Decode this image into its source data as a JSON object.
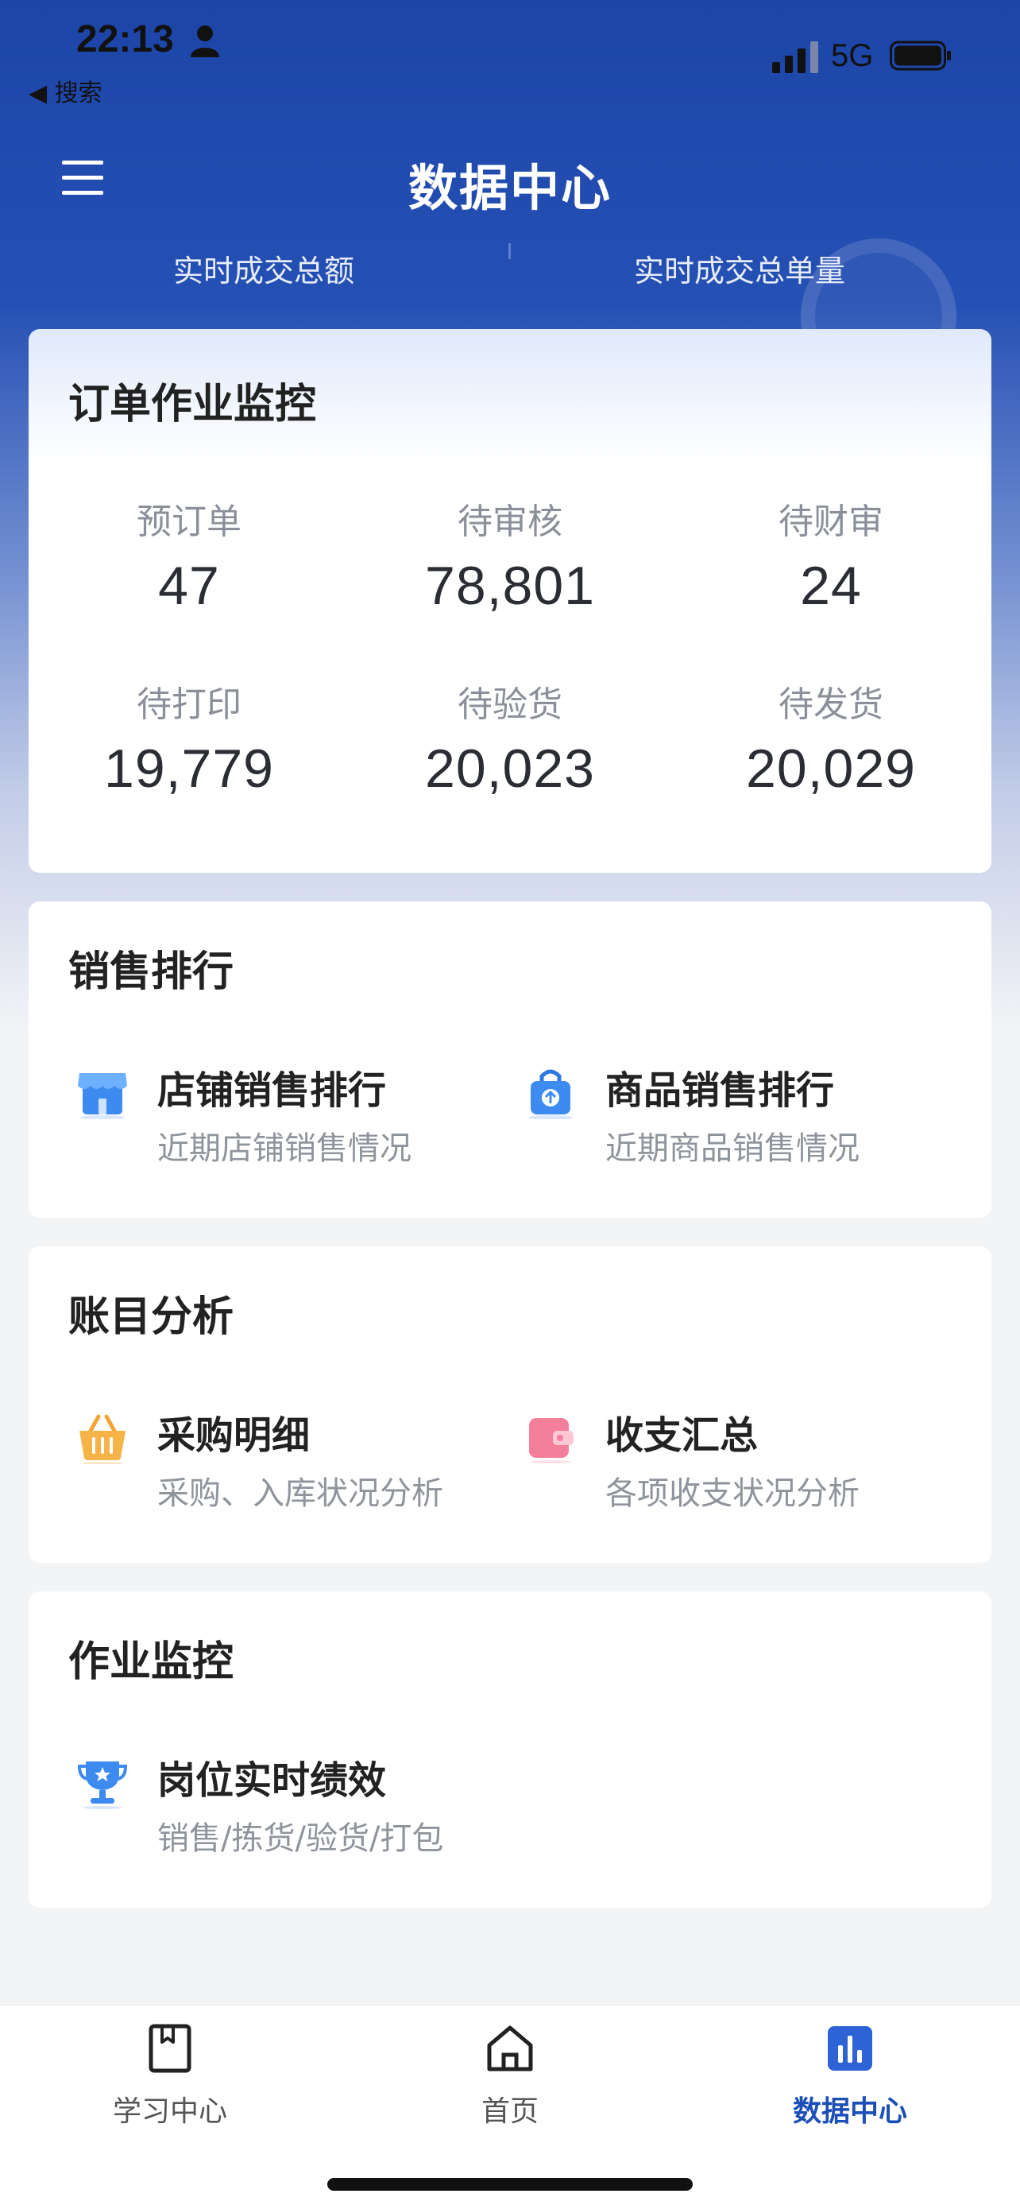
{
  "status_bar": {
    "time": "22:13",
    "back_app": "◀ 搜索",
    "network": "5G"
  },
  "header": {
    "title": "数据中心",
    "tabs": [
      "实时成交总额",
      "实时成交总单量"
    ]
  },
  "order_monitor": {
    "title": "订单作业监控",
    "metrics": [
      {
        "label": "预订单",
        "value": "47"
      },
      {
        "label": "待审核",
        "value": "78,801"
      },
      {
        "label": "待财审",
        "value": "24"
      },
      {
        "label": "待打印",
        "value": "19,779"
      },
      {
        "label": "待验货",
        "value": "20,023"
      },
      {
        "label": "待发货",
        "value": "20,029"
      }
    ]
  },
  "sales_rank": {
    "title": "销售排行",
    "items": [
      {
        "title": "店铺销售排行",
        "subtitle": "近期店铺销售情况",
        "icon": "shop-icon"
      },
      {
        "title": "商品销售排行",
        "subtitle": "近期商品销售情况",
        "icon": "shopping-bag-icon"
      }
    ]
  },
  "account_analysis": {
    "title": "账目分析",
    "items": [
      {
        "title": "采购明细",
        "subtitle": "采购、入库状况分析",
        "icon": "basket-icon"
      },
      {
        "title": "收支汇总",
        "subtitle": "各项收支状况分析",
        "icon": "wallet-icon"
      }
    ]
  },
  "work_monitor": {
    "title": "作业监控",
    "items": [
      {
        "title": "岗位实时绩效",
        "subtitle": "销售/拣货/验货/打包",
        "icon": "trophy-icon"
      }
    ]
  },
  "bottom_nav": {
    "items": [
      {
        "label": "学习中心",
        "icon": "book-icon"
      },
      {
        "label": "首页",
        "icon": "home-icon"
      },
      {
        "label": "数据中心",
        "icon": "bar-chart-icon",
        "active": true
      }
    ]
  },
  "colors": {
    "primary": "#1d4fb8",
    "header_bg": "#2550b4",
    "muted_text": "#8f949c"
  }
}
